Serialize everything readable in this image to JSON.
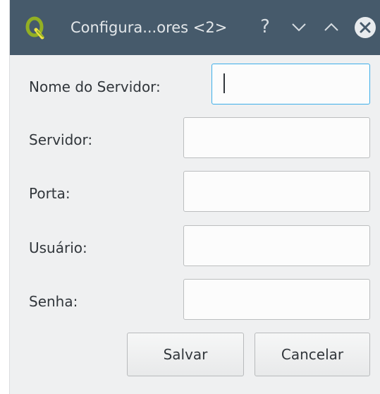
{
  "window": {
    "title": "Configura...ores <2>",
    "help_glyph": "?",
    "minimize_glyph": "∨",
    "maximize_glyph": "∧",
    "app_icon": "qgis-logo-icon",
    "titlebar_color": "#465a6b"
  },
  "form": {
    "server_name_label": "Nome do Servidor:",
    "server_name_value": "",
    "server_label": "Servidor:",
    "server_value": "",
    "port_label": "Porta:",
    "port_value": "",
    "user_label": "Usuário:",
    "user_value": "",
    "password_label": "Senha:",
    "password_value": ""
  },
  "buttons": {
    "save_label": "Salvar",
    "cancel_label": "Cancelar"
  },
  "colors": {
    "focus_border": "#3daee9",
    "window_bg": "#eff0f1"
  }
}
